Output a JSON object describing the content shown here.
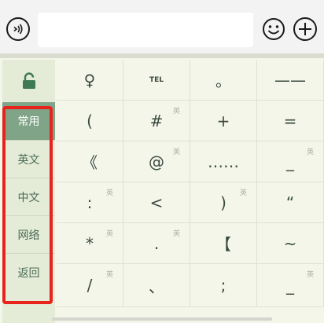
{
  "toolbar": {
    "voice_icon": "voice-icon",
    "input_value": "",
    "emoji_icon": "smiley-face-icon",
    "plus_icon": "plus-circle-icon"
  },
  "sidebar": {
    "lock_icon": "unlock-icon",
    "items": [
      {
        "label": "常用",
        "active": true
      },
      {
        "label": "英文",
        "active": false
      },
      {
        "label": "中文",
        "active": false
      },
      {
        "label": "网络",
        "active": false
      },
      {
        "label": "返回",
        "active": false
      }
    ]
  },
  "symbol_keys": [
    [
      {
        "ch": "♀",
        "badge": ""
      },
      {
        "ch": "TEL",
        "badge": ""
      },
      {
        "ch": "。",
        "badge": ""
      },
      {
        "ch": "——",
        "badge": ""
      }
    ],
    [
      {
        "ch": "(",
        "badge": ""
      },
      {
        "ch": "#",
        "badge": "英"
      },
      {
        "ch": "+",
        "badge": ""
      },
      {
        "ch": "=",
        "badge": ""
      }
    ],
    [
      {
        "ch": "《",
        "badge": ""
      },
      {
        "ch": "@",
        "badge": "英"
      },
      {
        "ch": "……",
        "badge": ""
      },
      {
        "ch": "_",
        "badge": "英"
      }
    ],
    [
      {
        "ch": ":",
        "badge": "英"
      },
      {
        "ch": "<",
        "badge": ""
      },
      {
        "ch": ")",
        "badge": "英"
      },
      {
        "ch": "“",
        "badge": ""
      }
    ],
    [
      {
        "ch": "*",
        "badge": "英"
      },
      {
        "ch": ".",
        "badge": "英"
      },
      {
        "ch": "【",
        "badge": ""
      },
      {
        "ch": "~",
        "badge": ""
      }
    ],
    [
      {
        "ch": "/",
        "badge": "英"
      },
      {
        "ch": "、",
        "badge": ""
      },
      {
        "ch": ";",
        "badge": ""
      },
      {
        "ch": "_",
        "badge": "英"
      }
    ]
  ],
  "colors": {
    "highlight_frame": "#e8231c",
    "active_tab": "#7fa487",
    "key_text": "#3b4a3f"
  }
}
